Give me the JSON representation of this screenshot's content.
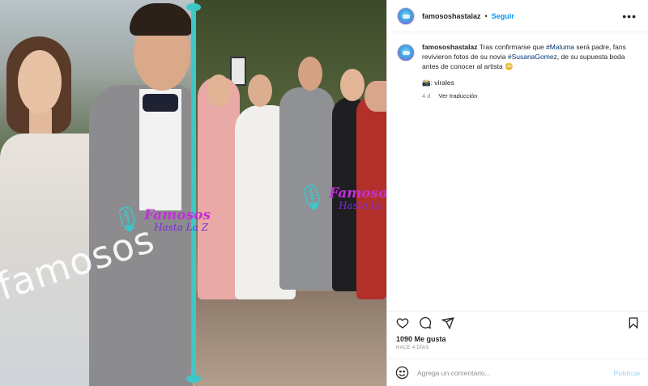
{
  "post": {
    "username": "famososhastalaz",
    "separator": "•",
    "follow_label": "Seguir",
    "more_label": "•••",
    "caption": {
      "username": "famososhastalaz",
      "text_1": " Tras confirmarse que ",
      "tag_maluma": "#Maluma",
      "text_2": " será padre, fans revivieron fotos de su novia ",
      "tag_susana": "#SusanaGomez",
      "text_3": ", de su supuesta boda antes de conocer al artista 😳",
      "tags_line": "📸: virales",
      "time_ago": "4 d",
      "translate_label": "Ver traducción"
    },
    "likes": "1090 Me gusta",
    "date": "HACE 4 DÍAS",
    "comment_placeholder": "Agrega un comentario...",
    "publish_label": "Publicar"
  },
  "photo": {
    "watermark_big": "famosos",
    "watermark_logo_line1": "Famosos",
    "watermark_logo_line2": "Hasta La Z",
    "mic_glyph": "🎙"
  },
  "icons": {
    "like": "heart-icon",
    "comment": "comment-icon",
    "share": "share-icon",
    "save": "bookmark-icon",
    "emoji": "emoji-icon"
  },
  "colors": {
    "link_blue": "#0095f6",
    "hashtag": "#00376b",
    "divider": "#3fc6c9"
  }
}
